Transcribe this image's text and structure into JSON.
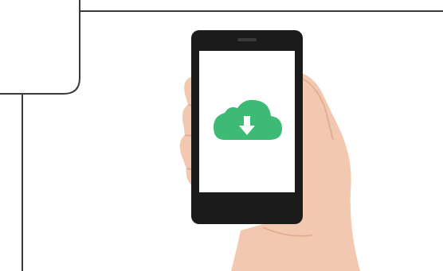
{
  "illustration": {
    "subject": "",
    "icon": "cloud-download-icon",
    "colors": {
      "background": "#ffffff",
      "border": "#3a3a3a",
      "phone_body": "#1b1b1b",
      "phone_screen": "#ffffff",
      "cloud": "#3dbb74",
      "arrow": "#ffffff",
      "skin": "#f2c9b0",
      "skin_shadow": "#e2ae93"
    }
  }
}
